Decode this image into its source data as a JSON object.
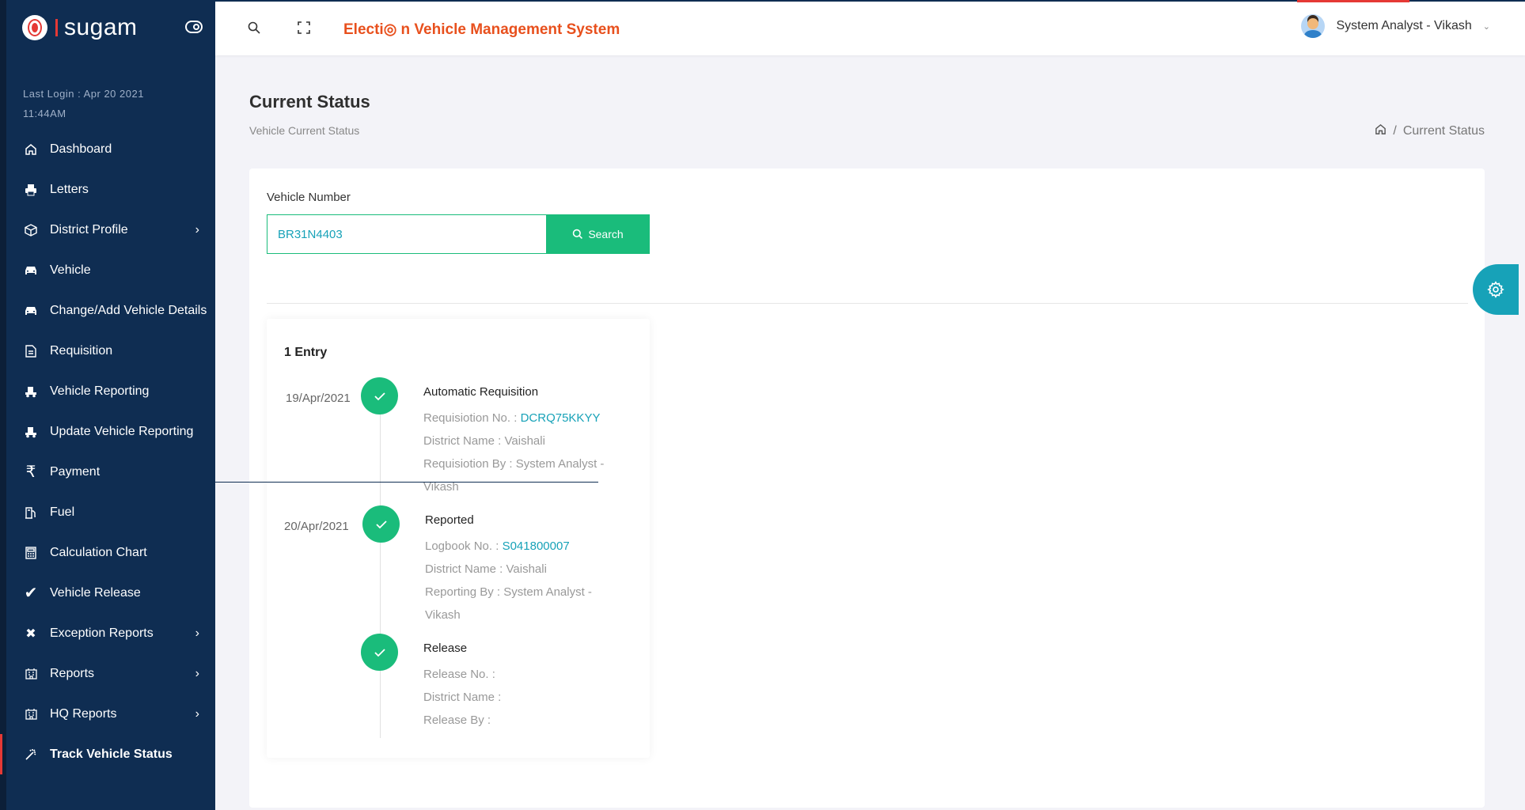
{
  "brand": {
    "name": "sugam"
  },
  "sidebar": {
    "last_login": "Last Login : Apr 20 2021 11:44AM",
    "items": [
      {
        "label": "Dashboard",
        "icon": "home-icon",
        "has_children": false
      },
      {
        "label": "Letters",
        "icon": "printer-icon",
        "has_children": false
      },
      {
        "label": "District Profile",
        "icon": "cube-icon",
        "has_children": true
      },
      {
        "label": "Vehicle",
        "icon": "car-icon",
        "has_children": false
      },
      {
        "label": "Change/Add Vehicle Details",
        "icon": "car-icon",
        "has_children": false
      },
      {
        "label": "Requisition",
        "icon": "document-icon",
        "has_children": false
      },
      {
        "label": "Vehicle Reporting",
        "icon": "truck-icon",
        "has_children": false
      },
      {
        "label": "Update Vehicle Reporting",
        "icon": "truck-icon",
        "has_children": false
      },
      {
        "label": "Payment",
        "icon": "rupee-icon",
        "has_children": false
      },
      {
        "label": "Fuel",
        "icon": "fuel-icon",
        "has_children": false
      },
      {
        "label": "Calculation Chart",
        "icon": "calculator-icon",
        "has_children": false
      },
      {
        "label": "Vehicle Release",
        "icon": "check-icon",
        "has_children": false
      },
      {
        "label": "Exception Reports",
        "icon": "close-icon",
        "has_children": true
      },
      {
        "label": "Reports",
        "icon": "building-icon",
        "has_children": true
      },
      {
        "label": "HQ Reports",
        "icon": "building-icon",
        "has_children": true
      },
      {
        "label": "Track Vehicle Status",
        "icon": "wand-icon",
        "has_children": false,
        "active": true
      }
    ]
  },
  "topbar": {
    "app_title": "Electi◎ n Vehicle Management System",
    "user_name": "System Analyst - Vikash"
  },
  "page": {
    "title": "Current Status",
    "subtitle": "Vehicle Current Status",
    "breadcrumb_current": "Current Status",
    "breadcrumb_sep": "/"
  },
  "search": {
    "label": "Vehicle Number",
    "value": "BR31N4403",
    "button_label": "Search"
  },
  "timeline": {
    "entry_count": "1 Entry",
    "events": [
      {
        "date": "19/Apr/2021",
        "title": "Automatic Requisition",
        "lines": [
          {
            "label": "Requisiotion No. : ",
            "value": "DCRQ75KKYY"
          },
          {
            "label": "District Name : Vaishali",
            "value": ""
          },
          {
            "label": "Requisiotion By : System Analyst - Vikash",
            "value": ""
          }
        ]
      },
      {
        "date": "20/Apr/2021",
        "title": "Reported",
        "lines": [
          {
            "label": "Logbook No. : ",
            "value": "S041800007"
          },
          {
            "label": "District Name : Vaishali",
            "value": ""
          },
          {
            "label": "Reporting By : System Analyst - Vikash",
            "value": ""
          }
        ]
      },
      {
        "date": "",
        "title": "Release",
        "lines": [
          {
            "label": "Release No. :",
            "value": ""
          },
          {
            "label": "District Name :",
            "value": ""
          },
          {
            "label": "Release By :",
            "value": ""
          }
        ]
      }
    ]
  },
  "colors": {
    "sidebar_bg": "#0f2d52",
    "accent_green": "#1abc7b",
    "accent_orange": "#e8501d",
    "teal": "#17a2b8"
  }
}
